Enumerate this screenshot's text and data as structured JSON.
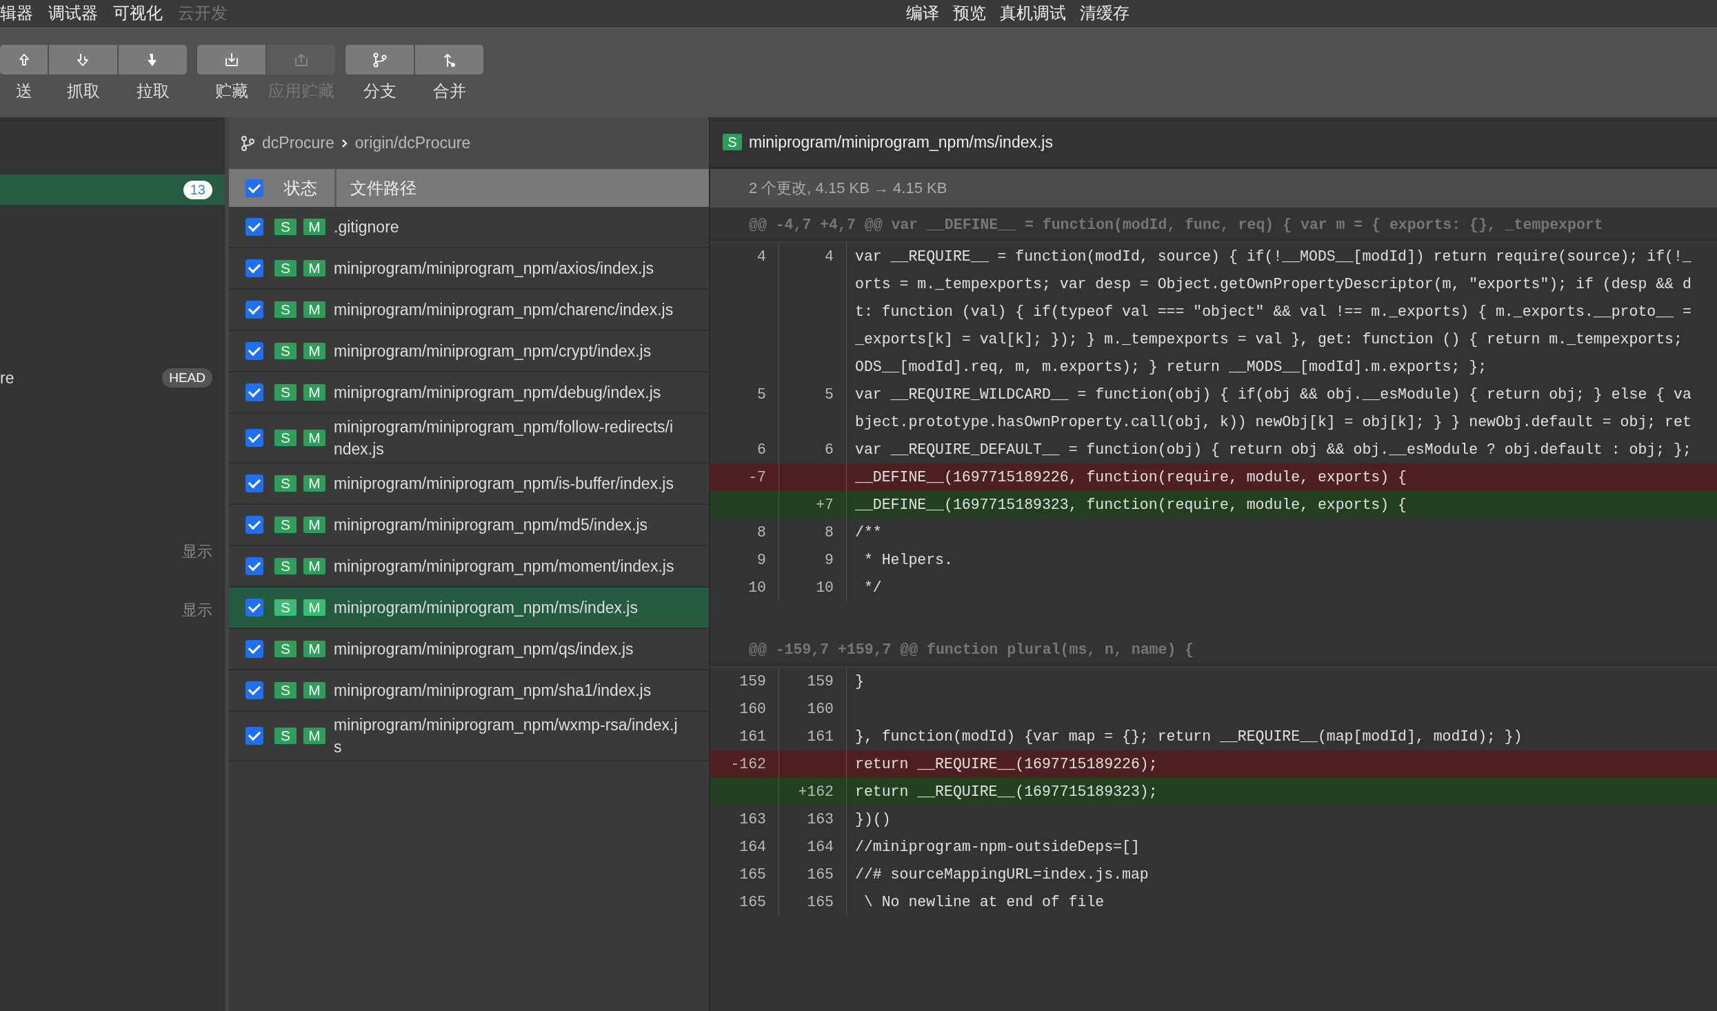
{
  "menu": {
    "left": [
      {
        "label": "辑器",
        "disabled": false
      },
      {
        "label": "调试器",
        "disabled": false
      },
      {
        "label": "可视化",
        "disabled": false
      },
      {
        "label": "云开发",
        "disabled": true
      }
    ],
    "right": [
      "编译",
      "预览",
      "真机调试",
      "清缓存"
    ]
  },
  "toolbar": {
    "groups": [
      [
        {
          "kind": "push",
          "label": "送",
          "disabled": false
        },
        {
          "kind": "fetch",
          "label": "抓取",
          "disabled": false
        },
        {
          "kind": "pull",
          "label": "拉取",
          "disabled": false
        }
      ],
      [
        {
          "kind": "stash",
          "label": "贮藏",
          "disabled": false
        },
        {
          "kind": "unstash",
          "label": "应用贮藏",
          "disabled": true
        }
      ],
      [
        {
          "kind": "branch",
          "label": "分支",
          "disabled": false
        },
        {
          "kind": "merge",
          "label": "合并",
          "disabled": false
        }
      ]
    ]
  },
  "sidebar": {
    "items": [
      {
        "kind": "changes",
        "selected": true,
        "badge": "13"
      },
      {
        "kind": "branch",
        "text": "re",
        "tag": "HEAD"
      },
      {
        "kind": "hint",
        "text": "显示"
      },
      {
        "kind": "hint",
        "text": "显示"
      }
    ]
  },
  "file_list": {
    "branch": {
      "local": "dcProcure",
      "remote": "origin/dcProcure"
    },
    "all_checked": true,
    "columns": [
      "状态",
      "文件路径"
    ],
    "files": [
      {
        "checked": true,
        "staged": "S",
        "status": "M",
        "selected": false,
        "path_lines": [
          ".gitignore"
        ]
      },
      {
        "checked": true,
        "staged": "S",
        "status": "M",
        "selected": false,
        "path_lines": [
          "miniprogram/miniprogram_npm/axios/index.js"
        ]
      },
      {
        "checked": true,
        "staged": "S",
        "status": "M",
        "selected": false,
        "path_lines": [
          "miniprogram/miniprogram_npm/charenc/index.js"
        ]
      },
      {
        "checked": true,
        "staged": "S",
        "status": "M",
        "selected": false,
        "path_lines": [
          "miniprogram/miniprogram_npm/crypt/index.js"
        ]
      },
      {
        "checked": true,
        "staged": "S",
        "status": "M",
        "selected": false,
        "path_lines": [
          "miniprogram/miniprogram_npm/debug/index.js"
        ]
      },
      {
        "checked": true,
        "staged": "S",
        "status": "M",
        "selected": false,
        "path_lines": [
          "miniprogram/miniprogram_npm/follow-redirects/i",
          "ndex.js"
        ]
      },
      {
        "checked": true,
        "staged": "S",
        "status": "M",
        "selected": false,
        "path_lines": [
          "miniprogram/miniprogram_npm/is-buffer/index.js"
        ]
      },
      {
        "checked": true,
        "staged": "S",
        "status": "M",
        "selected": false,
        "path_lines": [
          "miniprogram/miniprogram_npm/md5/index.js"
        ]
      },
      {
        "checked": true,
        "staged": "S",
        "status": "M",
        "selected": false,
        "path_lines": [
          "miniprogram/miniprogram_npm/moment/index.js"
        ]
      },
      {
        "checked": true,
        "staged": "S",
        "status": "M",
        "selected": true,
        "path_lines": [
          "miniprogram/miniprogram_npm/ms/index.js"
        ]
      },
      {
        "checked": true,
        "staged": "S",
        "status": "M",
        "selected": false,
        "path_lines": [
          "miniprogram/miniprogram_npm/qs/index.js"
        ]
      },
      {
        "checked": true,
        "staged": "S",
        "status": "M",
        "selected": false,
        "path_lines": [
          "miniprogram/miniprogram_npm/sha1/index.js"
        ]
      },
      {
        "checked": true,
        "staged": "S",
        "status": "M",
        "selected": false,
        "path_lines": [
          "miniprogram/miniprogram_npm/wxmp-rsa/index.j",
          "s"
        ]
      }
    ]
  },
  "diff": {
    "file": {
      "badge": "S",
      "path": "miniprogram/miniprogram_npm/ms/index.js"
    },
    "summary": "2 个更改, 4.15 KB → 4.15 KB",
    "hunks": [
      {
        "header": "@@ -4,7 +4,7 @@ var __DEFINE__ = function(modId, func, req) { var m = { exports: {}, _tempexport",
        "lines": [
          {
            "kind": "context",
            "old": "4",
            "new": "4",
            "text": [
              "var __REQUIRE__ = function(modId, source) { if(!__MODS__[modId]) return require(source); if(!_",
              "orts = m._tempexports; var desp = Object.getOwnPropertyDescriptor(m, \"exports\"); if (desp && d",
              "t: function (val) { if(typeof val === \"object\" && val !== m._exports) { m._exports.__proto__ =",
              "_exports[k] = val[k]; }); } m._tempexports = val }, get: function () { return m._tempexports;",
              "ODS__[modId].req, m, m.exports); } return __MODS__[modId].m.exports; };"
            ]
          },
          {
            "kind": "context",
            "old": "5",
            "new": "5",
            "text": [
              "var __REQUIRE_WILDCARD__ = function(obj) { if(obj && obj.__esModule) { return obj; } else { va",
              "bject.prototype.hasOwnProperty.call(obj, k)) newObj[k] = obj[k]; } } newObj.default = obj; ret"
            ]
          },
          {
            "kind": "context",
            "old": "6",
            "new": "6",
            "text": [
              "var __REQUIRE_DEFAULT__ = function(obj) { return obj && obj.__esModule ? obj.default : obj; };"
            ]
          },
          {
            "kind": "removed",
            "old": "-7",
            "text": [
              "__DEFINE__(1697715189226, function(require, module, exports) {"
            ]
          },
          {
            "kind": "added",
            "new": "+7",
            "text": [
              "__DEFINE__(1697715189323, function(require, module, exports) {"
            ]
          },
          {
            "kind": "context",
            "old": "8",
            "new": "8",
            "text": [
              "/**"
            ]
          },
          {
            "kind": "context",
            "old": "9",
            "new": "9",
            "text": [
              " * Helpers."
            ]
          },
          {
            "kind": "context",
            "old": "10",
            "new": "10",
            "text": [
              " */"
            ]
          }
        ]
      },
      {
        "header": "@@ -159,7 +159,7 @@ function plural(ms, n, name) {",
        "lines": [
          {
            "kind": "context",
            "old": "159",
            "new": "159",
            "text": [
              "}"
            ]
          },
          {
            "kind": "context",
            "old": "160",
            "new": "160"
          },
          {
            "kind": "context",
            "old": "161",
            "new": "161",
            "text": [
              "}, function(modId) {var map = {}; return __REQUIRE__(map[modId], modId); })"
            ]
          },
          {
            "kind": "removed",
            "old": "-162",
            "text": [
              "return __REQUIRE__(1697715189226);"
            ]
          },
          {
            "kind": "added",
            "new": "+162",
            "text": [
              "return __REQUIRE__(1697715189323);"
            ]
          },
          {
            "kind": "context",
            "old": "163",
            "new": "163",
            "text": [
              "})()"
            ]
          },
          {
            "kind": "context",
            "old": "164",
            "new": "164",
            "text": [
              "//miniprogram-npm-outsideDeps=[]"
            ]
          },
          {
            "kind": "context",
            "old": "165",
            "new": "165",
            "text": [
              "//# sourceMappingURL=index.js.map"
            ]
          },
          {
            "kind": "context",
            "old": "165",
            "new": "165",
            "text": [
              " \\ No newline at end of file"
            ]
          }
        ]
      }
    ]
  }
}
